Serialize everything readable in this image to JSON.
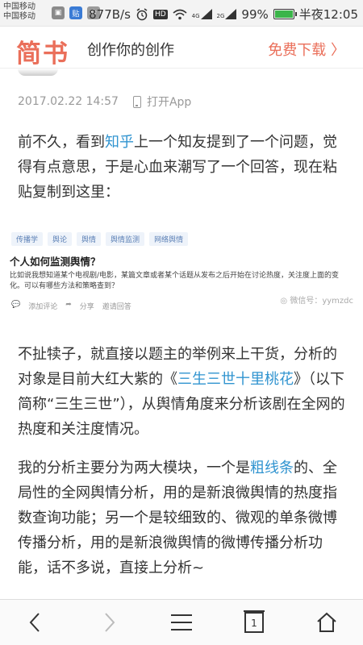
{
  "status_bar": {
    "carrier_1": "中国移动",
    "carrier_2": "中国移动",
    "tieba_icon_label": "贴",
    "speed": "877B/s",
    "network_4g": "4G",
    "network_2g": "2G",
    "battery": "99%",
    "time": "半夜12:05",
    "battery_level": 0.99
  },
  "header": {
    "logo": "简书",
    "tagline": "创作你的创作",
    "download": "免费下载 〉"
  },
  "article": {
    "date": "2017.02.22 14:57",
    "open_app": "打开App",
    "p1_before": "前不久，看到",
    "p1_link": "知乎",
    "p1_after": "上一个知友提到了一个问题，觉得有点意思，于是心血来潮写了一个回答，现在粘贴复制到这里：",
    "embed": {
      "tags": [
        "传播学",
        "舆论",
        "舆情",
        "舆情监测",
        "网络舆情"
      ],
      "title": "个人如何监测舆情？",
      "desc": "比如说我想知道某个电视剧/电影，某篇文章或者某个话题从发布之后开始在讨论热度，关注度上面的变化。可以有哪些方法和策略查到？",
      "actions": [
        "添加评论",
        "分享",
        "邀请回答"
      ],
      "watermark": "微信号：yymzdc"
    },
    "p2_before": "不扯犊子，就直接以题主的举例来上干货，分析的对象是目前大红大紫的《",
    "p2_link": "三生三世十里桃花",
    "p2_after": "》（以下简称“三生三世”），从舆情角度来分析该剧在全网的热度和关注度情况。",
    "p3_before": "我的分析主要分为两大模块，一个是",
    "p3_link": "粗线条",
    "p3_after": "的、全局性的全网舆情分析，用的是新浪微舆情的热度指数查询功能；另一个是较细致的、微观的单条微博传播分析，用的是新浪微舆情的微博传播分析功能，话不多说，直接上分析~"
  },
  "bottom_nav": {
    "tab_count": "1"
  },
  "colors": {
    "brand": "#ea6f5a",
    "link": "#3194d0"
  }
}
